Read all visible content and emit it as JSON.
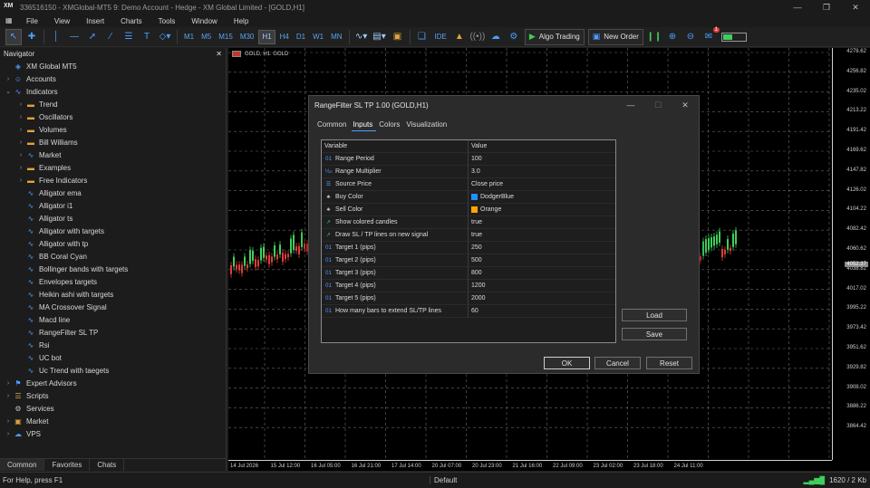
{
  "window": {
    "logo": "XM",
    "title": "336516150 - XMGlobal-MT5 9: Demo Account - Hedge - XM Global Limited - [GOLD,H1]",
    "controls": [
      "—",
      "❐",
      "✕"
    ]
  },
  "menu": {
    "items": [
      "File",
      "View",
      "Insert",
      "Charts",
      "Tools",
      "Window",
      "Help"
    ],
    "mdi_controls": [
      "—",
      "❐",
      "✕"
    ]
  },
  "toolbar": {
    "timeframes": [
      "M1",
      "M5",
      "M15",
      "M30",
      "H1",
      "H4",
      "D1",
      "W1",
      "MN"
    ],
    "selected_timeframe": "H1",
    "ide_label": "IDE",
    "algo_trading_label": "Algo Trading",
    "new_order_label": "New Order",
    "notification_count": "1"
  },
  "navigator": {
    "title": "Navigator",
    "close": "✕",
    "tree": [
      {
        "level": 0,
        "label": "XM Global MT5",
        "icon": "terminal-icon",
        "expander": ""
      },
      {
        "level": 0,
        "label": "Accounts",
        "icon": "accounts-icon",
        "expander": "›"
      },
      {
        "level": 0,
        "label": "Indicators",
        "icon": "indicators-icon",
        "expander": "⌄"
      },
      {
        "level": 1,
        "label": "Trend",
        "icon": "folder-icon",
        "expander": "›"
      },
      {
        "level": 1,
        "label": "Oscillators",
        "icon": "folder-icon",
        "expander": "›"
      },
      {
        "level": 1,
        "label": "Volumes",
        "icon": "folder-icon",
        "expander": "›"
      },
      {
        "level": 1,
        "label": "Bill Williams",
        "icon": "folder-icon",
        "expander": "›"
      },
      {
        "level": 1,
        "label": "Market",
        "icon": "indicator-icon",
        "expander": "›"
      },
      {
        "level": 1,
        "label": "Examples",
        "icon": "folder-icon",
        "expander": "›"
      },
      {
        "level": 1,
        "label": "Free Indicators",
        "icon": "folder-icon",
        "expander": "›"
      },
      {
        "level": 1,
        "label": "Alligator ema",
        "icon": "indicator-icon",
        "expander": ""
      },
      {
        "level": 1,
        "label": "Alligator i1",
        "icon": "indicator-icon",
        "expander": ""
      },
      {
        "level": 1,
        "label": "Alligator ts",
        "icon": "indicator-icon",
        "expander": ""
      },
      {
        "level": 1,
        "label": "Alligator with targets",
        "icon": "indicator-icon",
        "expander": ""
      },
      {
        "level": 1,
        "label": "Alligator with tp",
        "icon": "indicator-icon",
        "expander": ""
      },
      {
        "level": 1,
        "label": "BB Coral Cyan",
        "icon": "indicator-icon",
        "expander": ""
      },
      {
        "level": 1,
        "label": "Bollinger bands with targets",
        "icon": "indicator-icon",
        "expander": ""
      },
      {
        "level": 1,
        "label": "Envelopes targets",
        "icon": "indicator-icon",
        "expander": ""
      },
      {
        "level": 1,
        "label": "Heikin ashi with targets",
        "icon": "indicator-icon",
        "expander": ""
      },
      {
        "level": 1,
        "label": "MA Crossover Signal",
        "icon": "indicator-icon",
        "expander": ""
      },
      {
        "level": 1,
        "label": "Macd line",
        "icon": "indicator-icon",
        "expander": ""
      },
      {
        "level": 1,
        "label": "RangeFilter SL TP",
        "icon": "indicator-icon",
        "expander": ""
      },
      {
        "level": 1,
        "label": "Rsi",
        "icon": "indicator-icon",
        "expander": ""
      },
      {
        "level": 1,
        "label": "UC bot",
        "icon": "indicator-icon",
        "expander": ""
      },
      {
        "level": 1,
        "label": "Uc Trend with taegets",
        "icon": "indicator-icon",
        "expander": ""
      },
      {
        "level": 0,
        "label": "Expert Advisors",
        "icon": "expert-icon",
        "expander": "›"
      },
      {
        "level": 0,
        "label": "Scripts",
        "icon": "scripts-icon",
        "expander": "›"
      },
      {
        "level": 0,
        "label": "Services",
        "icon": "services-icon",
        "expander": ""
      },
      {
        "level": 0,
        "label": "Market",
        "icon": "market-icon",
        "expander": "›"
      },
      {
        "level": 0,
        "label": "VPS",
        "icon": "vps-icon",
        "expander": "›"
      }
    ],
    "tabs": [
      "Common",
      "Favorites",
      "Chats"
    ],
    "active_tab": "Common"
  },
  "chart": {
    "label": "GOLD, H1:  GOLD",
    "price_labels": [
      "4278.62",
      "4256.82",
      "4235.02",
      "4213.22",
      "4191.42",
      "4169.62",
      "4147.82",
      "4126.02",
      "4104.22",
      "4082.42",
      "4060.62",
      "4038.82",
      "4017.02",
      "3995.22",
      "3973.42",
      "3951.62",
      "3929.82",
      "3908.02",
      "3886.22",
      "3864.42"
    ],
    "current_price": "4052.37",
    "time_labels": [
      "14 Jul 2026",
      "15 Jul 12:00",
      "16 Jul 05:00",
      "16 Jul 21:00",
      "17 Jul 14:00",
      "20 Jul 07:00",
      "20 Jul 23:00",
      "21 Jul 16:00",
      "22 Jul 09:00",
      "23 Jul 02:00",
      "23 Jul 18:00",
      "24 Jul 11:00"
    ]
  },
  "dialog": {
    "title": "RangeFilter SL TP 1.00 (GOLD,H1)",
    "controls": [
      "—",
      "☐",
      "✕"
    ],
    "tabs": [
      "Common",
      "Inputs",
      "Colors",
      "Visualization"
    ],
    "active_tab": "Inputs",
    "columns": [
      "Variable",
      "Value"
    ],
    "params": [
      {
        "icon": "int-icon",
        "icon_text": "01",
        "name": "Range Period",
        "value": "100"
      },
      {
        "icon": "double-icon",
        "icon_text": "⅒",
        "name": "Range Multiplier",
        "value": "3.0"
      },
      {
        "icon": "enum-icon",
        "icon_text": "☰",
        "name": "Source Price",
        "value": "Close price"
      },
      {
        "icon": "color-icon",
        "icon_text": "♣",
        "name": "Buy Color",
        "value": "DodgerBlue",
        "swatch": "#1e90ff"
      },
      {
        "icon": "color-icon",
        "icon_text": "♣",
        "name": "Sell Color",
        "value": "Orange",
        "swatch": "#ffa500"
      },
      {
        "icon": "bool-icon",
        "icon_text": "↗",
        "name": "Show colored candles",
        "value": "true"
      },
      {
        "icon": "bool-icon",
        "icon_text": "↗",
        "name": "Draw SL / TP lines on new signal",
        "value": "true"
      },
      {
        "icon": "int-icon",
        "icon_text": "01",
        "name": "Target 1 (pips)",
        "value": "250"
      },
      {
        "icon": "int-icon",
        "icon_text": "01",
        "name": "Target 2 (pips)",
        "value": "500"
      },
      {
        "icon": "int-icon",
        "icon_text": "01",
        "name": "Target 3 (pips)",
        "value": "800"
      },
      {
        "icon": "int-icon",
        "icon_text": "01",
        "name": "Target 4 (pips)",
        "value": "1200"
      },
      {
        "icon": "int-icon",
        "icon_text": "01",
        "name": "Target 5 (pips)",
        "value": "2000"
      },
      {
        "icon": "int-icon",
        "icon_text": "01",
        "name": "How many bars to extend SL/TP lines",
        "value": "60"
      }
    ],
    "load_label": "Load",
    "save_label": "Save",
    "ok_label": "OK",
    "cancel_label": "Cancel",
    "reset_label": "Reset"
  },
  "status": {
    "help": "For Help, press F1",
    "profile": "Default",
    "connection": "1620 / 2 Kb"
  },
  "colors": {
    "bull_candle": "#3ecf5b",
    "bear_candle": "#e03c3c",
    "accent": "#4a9eff"
  }
}
